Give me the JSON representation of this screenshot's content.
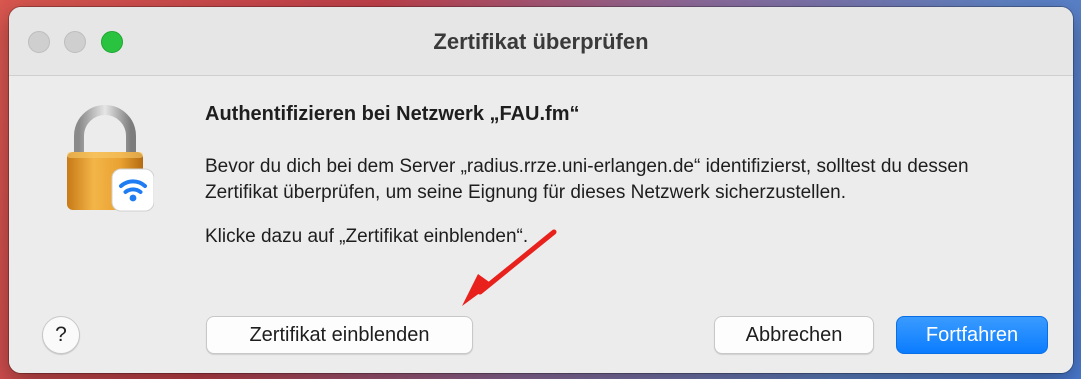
{
  "window": {
    "title": "Zertifikat überprüfen"
  },
  "dialog": {
    "heading": "Authentifizieren bei Netzwerk „FAU.fm“",
    "body": "Bevor du dich bei dem Server „radius.rrze.uni-erlangen.de“ identifizierst, solltest du dessen Zertifikat überprüfen, um seine Eignung für dieses Netzwerk sicherzustellen.",
    "hint": "Klicke dazu auf „Zertifikat einblenden“.",
    "icon": "lock-wifi-icon"
  },
  "buttons": {
    "help": "?",
    "show_certificate": "Zertifikat einblenden",
    "cancel": "Abbrechen",
    "continue": "Fortfahren"
  },
  "colors": {
    "accent": "#0b7cff",
    "annotation_arrow": "#e8211c"
  }
}
